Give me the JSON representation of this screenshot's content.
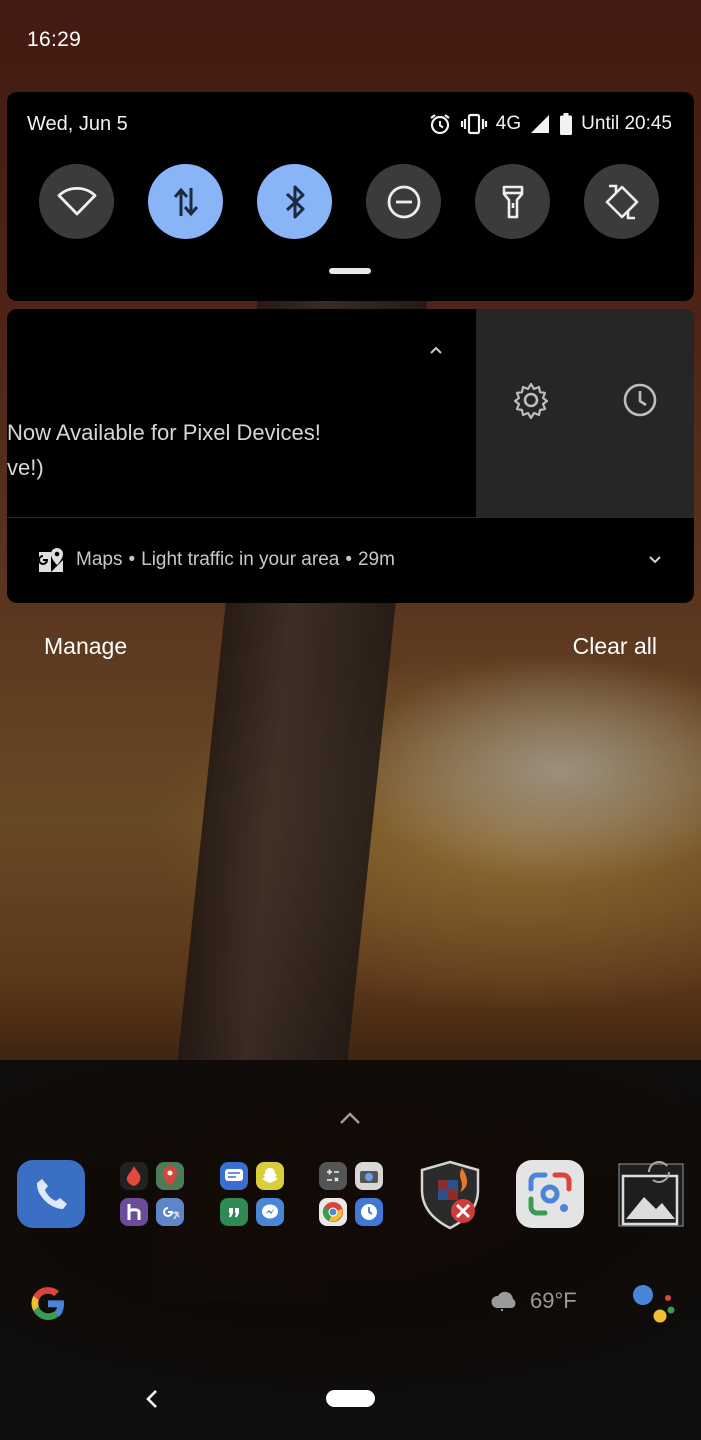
{
  "status_bar": {
    "time": "16:29"
  },
  "quick_settings": {
    "date": "Wed, Jun 5",
    "network": "4G",
    "battery_text": "Until 20:45",
    "tiles": [
      {
        "icon": "wifi-icon",
        "active": false
      },
      {
        "icon": "mobile-data-icon",
        "active": true
      },
      {
        "icon": "bluetooth-icon",
        "active": true
      },
      {
        "icon": "do-not-disturb-icon",
        "active": false
      },
      {
        "icon": "flashlight-icon",
        "active": false
      },
      {
        "icon": "auto-rotate-icon",
        "active": false
      }
    ],
    "active_color": "#8ab4f8",
    "inactive_color": "#3b3b3b"
  },
  "notifications": {
    "swiped": {
      "line1": "Now Available for Pixel Devices!",
      "line2": "ve!)"
    },
    "maps": {
      "app": "Maps",
      "text": "Light traffic in your area",
      "time": "29m"
    },
    "manage_label": "Manage",
    "clear_all_label": "Clear all"
  },
  "home": {
    "dock": [
      "phone-app-icon",
      "folder-icon",
      "folder-icon",
      "folder-icon",
      "security-app-icon",
      "google-lens-icon",
      "gallery-icon"
    ],
    "weather": "69°F"
  }
}
